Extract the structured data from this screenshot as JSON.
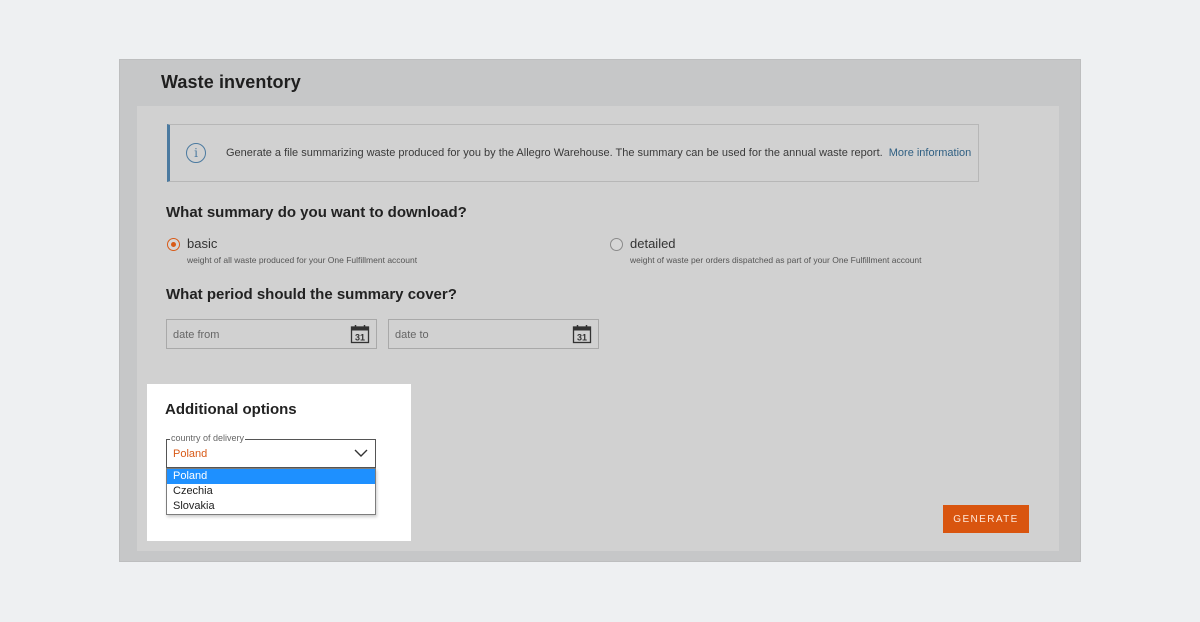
{
  "page": {
    "title": "Waste inventory"
  },
  "info": {
    "text": "Generate a file summarizing waste produced for you by the Allegro Warehouse. The summary can be used for the annual waste report.",
    "link": "More information",
    "icon": "info-icon"
  },
  "summary": {
    "question": "What summary do you want to download?",
    "options": [
      {
        "label": "basic",
        "description": "weight of all waste produced for your One Fulfillment account",
        "checked": true
      },
      {
        "label": "detailed",
        "description": "weight of waste per orders dispatched as part of your One Fulfillment account",
        "checked": false
      }
    ]
  },
  "period": {
    "question": "What period should the summary cover?",
    "from_placeholder": "date from",
    "to_placeholder": "date to",
    "calendar_day": "31"
  },
  "additional": {
    "title": "Additional options",
    "country_label": "country of delivery",
    "country_value": "Poland",
    "country_options": [
      "Poland",
      "Czechia",
      "Slovakia"
    ]
  },
  "actions": {
    "generate": "GENERATE"
  },
  "colors": {
    "accent": "#d85a17",
    "info": "#4b7aa0",
    "selection": "#1e90ff"
  }
}
